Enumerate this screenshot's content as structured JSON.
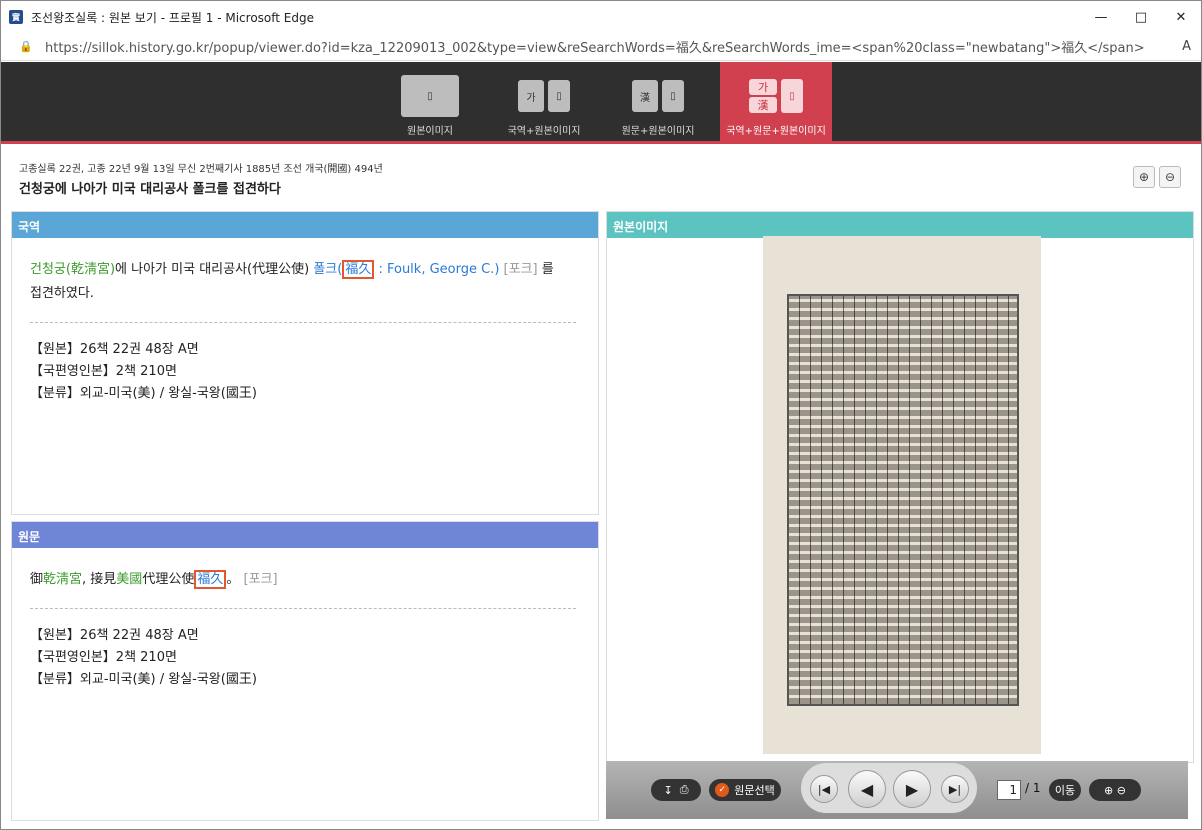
{
  "window": {
    "title": "조선왕조실록 : 원본 보기 - 프로필 1 - Microsoft Edge",
    "url": "https://sillok.history.go.kr/popup/viewer.do?id=kza_12209013_002&type=view&reSearchWords=福久&reSearchWords_ime=<span%20class=\"newbatang\">福久</span>"
  },
  "view_tabs": [
    {
      "label": "원본이미지",
      "glyph": ""
    },
    {
      "label": "국역+원본이미지",
      "glyph": "가"
    },
    {
      "label": "원문+원본이미지",
      "glyph": "漢"
    },
    {
      "label": "국역+원문+원본이미지",
      "glyph": "가"
    }
  ],
  "header": {
    "crumb": "고종실록 22권, 고종 22년 9월 13일 무신 2번째기사 1885년 조선 개국(開國) 494년",
    "title": "건청궁에 나아가 미국 대리공사 폴크를 접견하다"
  },
  "translation": {
    "heading": "국역",
    "t1": "건청궁(乾淸宮)",
    "t2": "에 나아가 미국 대리공사(代理公使) ",
    "t3": "폴크(",
    "t4": "福久",
    "t5": " : Foulk, George C.)",
    "t6": " [포크]",
    "t7": " 를",
    "t8": "접견하였다.",
    "refs": [
      "【원본】26책 22권 48장 A면",
      "【국편영인본】2책 210면",
      "【분류】외교-미국(美) / 왕실-국왕(國王)"
    ]
  },
  "original": {
    "heading": "원문",
    "o1": "御",
    "o2": "乾淸宮",
    "o3": ", 接見",
    "o4": "美國",
    "o5": "代理公使",
    "o6": "福久",
    "o7": "。",
    "o8": " [포크]",
    "refs": [
      "【원본】26책 22권 48장 A면",
      "【국편영인본】2책 210면",
      "【분류】외교-미국(美) / 왕실-국왕(國王)"
    ]
  },
  "image_panel": {
    "heading": "원본이미지"
  },
  "controls": {
    "select_label": "원문선택",
    "page": "1",
    "total": "/ 1",
    "go_label": "이동"
  }
}
